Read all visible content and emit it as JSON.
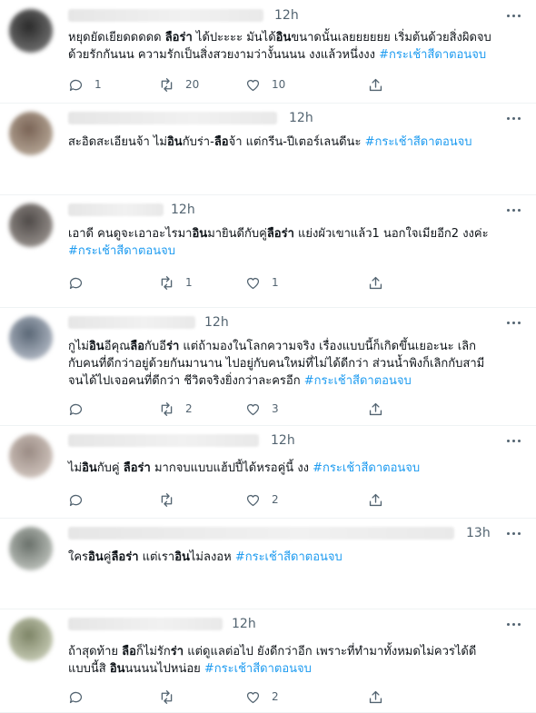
{
  "colors": {
    "hashtag": "#1d9bf0",
    "muted": "#536471",
    "text": "#0f1419",
    "divider": "#eff3f4"
  },
  "tweets": [
    {
      "time": "12h",
      "lines": [
        [
          [
            "หยุดยัดเยียดดดดด ",
            ""
          ],
          [
            "ลือร่า",
            "b"
          ],
          [
            " ได้ปะะะะ มันได้",
            ""
          ],
          [
            "อิน",
            "b"
          ],
          [
            "ขนาดนั้นเลยยยยยย เริ่มต้นด้วยสิ่งผิดจบ",
            ""
          ]
        ],
        [
          [
            "ด้วยรักกันนน ความรักเป็นสิ่งสวยงามว่างั้นนนน งงแล้วหนึ่งงง ",
            ""
          ],
          [
            "#กระเช้าสีดาตอนจบ",
            "h"
          ]
        ]
      ],
      "replies": "1",
      "retweets": "20",
      "likes": "10"
    },
    {
      "time": "12h",
      "lines": [
        [
          [
            "สะอิดสะเอียนจ้า ไม่",
            ""
          ],
          [
            "อิน",
            "b"
          ],
          [
            "กับร่า-",
            ""
          ],
          [
            "ลือ",
            "b"
          ],
          [
            "จ้า แต่กรีน-ปีเตอร์เลนดีนะ ",
            ""
          ],
          [
            "#กระเช้าสีดาตอนจบ",
            "h"
          ]
        ]
      ],
      "replies": "",
      "retweets": "",
      "likes": ""
    },
    {
      "time": "12h",
      "lines": [
        [
          [
            "เอาดี คนดูจะเอาอะไรมา",
            ""
          ],
          [
            "อิน",
            "b"
          ],
          [
            "มายินดีกับคู่",
            ""
          ],
          [
            "ลือร่า",
            "b"
          ],
          [
            " แย่งผัวเขาแล้ว1 นอกใจเมียอีก2 งงค่ะ",
            ""
          ]
        ],
        [
          [
            "#กระเช้าสีดาตอนจบ",
            "h"
          ]
        ]
      ],
      "replies": "",
      "retweets": "1",
      "likes": "1"
    },
    {
      "time": "12h",
      "lines": [
        [
          [
            "กูไม่",
            ""
          ],
          [
            "อิน",
            "b"
          ],
          [
            "อีคุณ",
            ""
          ],
          [
            "ลือ",
            "b"
          ],
          [
            "กับอี",
            ""
          ],
          [
            "ร่า",
            "b"
          ],
          [
            " แต่ถ้ามองในโลกความจริง เรื่องแบบนี้ก็เกิดขึ้นเยอะนะ เลิก",
            ""
          ]
        ],
        [
          [
            "กับคนที่ดีกว่าอยู่ด้วยกันมานาน ไปอยู่กับคนใหม่ที่ไม่ได้ดีกว่า ส่วนน้ำพิงก็เลิกกับสามี",
            ""
          ]
        ],
        [
          [
            "จนได้ไปเจอคนที่ดีกว่า ชีวิตจริงยิ่งกว่าละครอีก ",
            ""
          ],
          [
            "#กระเช้าสีดาตอนจบ",
            "h"
          ]
        ]
      ],
      "replies": "",
      "retweets": "2",
      "likes": "3"
    },
    {
      "time": "12h",
      "lines": [
        [
          [
            "ไม่",
            ""
          ],
          [
            "อิน",
            "b"
          ],
          [
            "กับคู่ ",
            ""
          ],
          [
            "ลือร่า",
            "b"
          ],
          [
            " มากจบแบบแฮ้ปปี้ได้หรอคู่นี้ งง ",
            ""
          ],
          [
            "#กระเช้าสีดาตอนจบ",
            "h"
          ]
        ]
      ],
      "replies": "",
      "retweets": "",
      "likes": "2"
    },
    {
      "time": "13h",
      "lines": [
        [
          [
            "ใคร",
            ""
          ],
          [
            "อิน",
            "b"
          ],
          [
            "คู่",
            ""
          ],
          [
            "ลือร่า",
            "b"
          ],
          [
            " แต่เรา",
            ""
          ],
          [
            "อิน",
            "b"
          ],
          [
            "ไม่ลงอห ",
            ""
          ],
          [
            "#กระเช้าสีดาตอนจบ",
            "h"
          ]
        ]
      ],
      "replies": "",
      "retweets": "",
      "likes": ""
    },
    {
      "time": "12h",
      "lines": [
        [
          [
            "ถ้าสุดท้าย ",
            ""
          ],
          [
            "ลือ",
            "b"
          ],
          [
            "ก็ไม่รัก",
            ""
          ],
          [
            "ร่า",
            "b"
          ],
          [
            " แต่ดูแลต่อไป ยังดีกว่าอีก เพราะที่ทำมาทั้งหมดไม่ควรได้ดี",
            ""
          ]
        ],
        [
          [
            "แบบนี้สิ ",
            ""
          ],
          [
            "อิน",
            "b"
          ],
          [
            "นนนนไปหน่อย ",
            ""
          ],
          [
            "#กระเช้าสีดาตอนจบ",
            "h"
          ]
        ]
      ],
      "replies": "",
      "retweets": "",
      "likes": "2"
    }
  ]
}
